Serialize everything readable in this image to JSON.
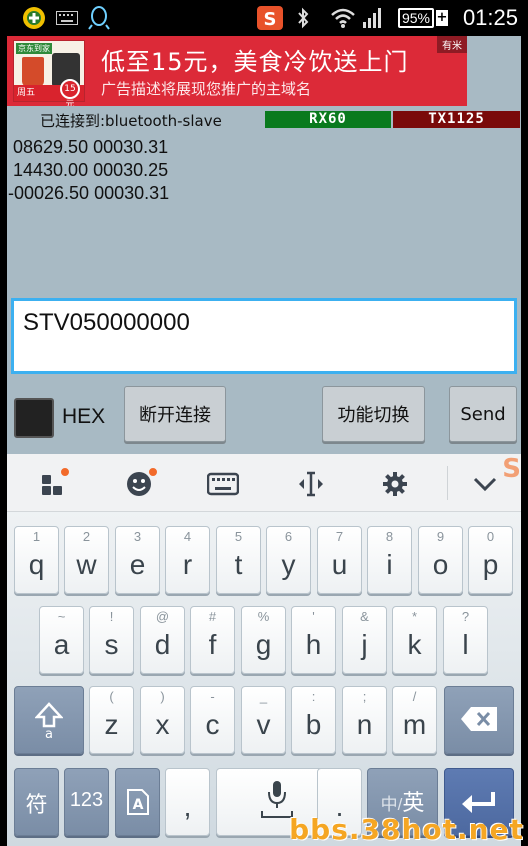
{
  "status_bar": {
    "icons": [
      "app-icon",
      "keyboard-icon",
      "qq-icon",
      "sogou-icon",
      "bluetooth-icon",
      "wifi-icon",
      "signal-icon"
    ],
    "battery": "95%",
    "battery_plus": "+",
    "time": "01:25"
  },
  "ad": {
    "title": "低至15元，美食冷饮送上门",
    "description": "广告描述将展现您推广的主域名",
    "badge": "有米",
    "thumb_tag": "京东到家",
    "thumb_day": "周五",
    "thumb_price": "15元"
  },
  "connection": {
    "status": "已连接到:bluetooth-slave",
    "rx": "RX60",
    "tx": "TX1125"
  },
  "received_lines": [
    " 08629.50 00030.31",
    " 14430.00 00030.25",
    "-00026.50 00030.31"
  ],
  "send_input": {
    "value": "STV050000000"
  },
  "controls": {
    "hex_label": "HEX",
    "disconnect_label": "断开连接",
    "function_switch_label": "功能切换",
    "send_label": "Send"
  },
  "keyboard": {
    "row1": [
      {
        "sub": "1",
        "main": "q"
      },
      {
        "sub": "2",
        "main": "w"
      },
      {
        "sub": "3",
        "main": "e"
      },
      {
        "sub": "4",
        "main": "r"
      },
      {
        "sub": "5",
        "main": "t"
      },
      {
        "sub": "6",
        "main": "y"
      },
      {
        "sub": "7",
        "main": "u"
      },
      {
        "sub": "8",
        "main": "i"
      },
      {
        "sub": "9",
        "main": "o"
      },
      {
        "sub": "0",
        "main": "p"
      }
    ],
    "row2": [
      {
        "sub": "~",
        "main": "a"
      },
      {
        "sub": "!",
        "main": "s"
      },
      {
        "sub": "@",
        "main": "d"
      },
      {
        "sub": "#",
        "main": "f"
      },
      {
        "sub": "%",
        "main": "g"
      },
      {
        "sub": "'",
        "main": "h"
      },
      {
        "sub": "&",
        "main": "j"
      },
      {
        "sub": "*",
        "main": "k"
      },
      {
        "sub": "?",
        "main": "l"
      }
    ],
    "row3": [
      {
        "sub": "(",
        "main": "z"
      },
      {
        "sub": ")",
        "main": "x"
      },
      {
        "sub": "-",
        "main": "c"
      },
      {
        "sub": "_",
        "main": "v"
      },
      {
        "sub": ":",
        "main": "b"
      },
      {
        "sub": ";",
        "main": "n"
      },
      {
        "sub": "/",
        "main": "m"
      }
    ],
    "symbols_label": "符",
    "numbers_label": "123",
    "comma_label": ",",
    "period_label": ".",
    "lang_label_cn": "中/",
    "lang_label_en": "英"
  },
  "watermark": "bbs.38hot.net"
}
